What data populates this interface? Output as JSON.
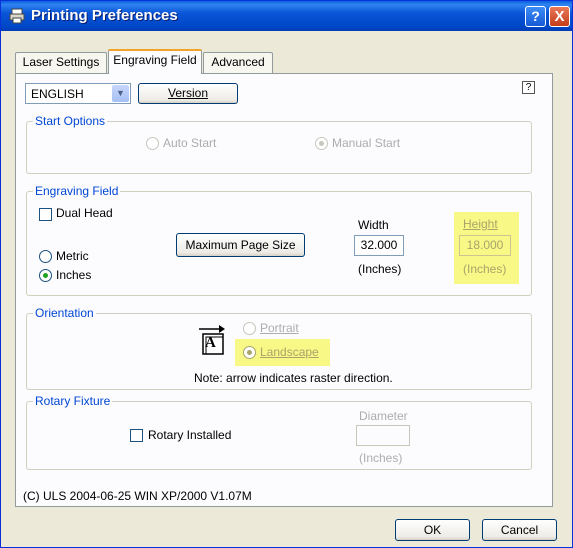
{
  "window": {
    "title": "Printing Preferences",
    "help_glyph": "?",
    "close_glyph": "X"
  },
  "tabs": [
    {
      "label": "Laser Settings"
    },
    {
      "label": "Engraving Field"
    },
    {
      "label": "Advanced"
    }
  ],
  "toolbar": {
    "language_value": "ENGLISH",
    "version_label": "Version",
    "help_glyph": "?"
  },
  "start_options": {
    "title": "Start Options",
    "auto_start": "Auto Start",
    "manual_start": "Manual Start",
    "selected": "manual_start"
  },
  "engraving_field": {
    "title": "Engraving Field",
    "dual_head": "Dual Head",
    "metric": "Metric",
    "inches": "Inches",
    "selected_unit": "inches",
    "max_page_button": "Maximum Page Size",
    "width_label": "Width",
    "width_value": "32.000",
    "width_unit": "(Inches)",
    "height_label": "Height",
    "height_value": "18.000",
    "height_unit": "(Inches)"
  },
  "orientation": {
    "title": "Orientation",
    "portrait": "Portrait",
    "landscape": "Landscape",
    "selected": "landscape",
    "note": "Note: arrow indicates raster direction.",
    "icon_glyph": "A"
  },
  "rotary": {
    "title": "Rotary Fixture",
    "installed_label": "Rotary Installed",
    "diameter_label": "Diameter",
    "diameter_value": "",
    "diameter_unit": "(Inches)"
  },
  "footer": {
    "version_text": "(C) ULS 2004-06-25 WIN XP/2000 V1.07M",
    "ok_label": "OK",
    "cancel_label": "Cancel"
  },
  "colors": {
    "titlebar": "#0054e3",
    "group_title": "#0046d5",
    "highlight": "#f7f75f",
    "radio_selected": "#21a121"
  }
}
